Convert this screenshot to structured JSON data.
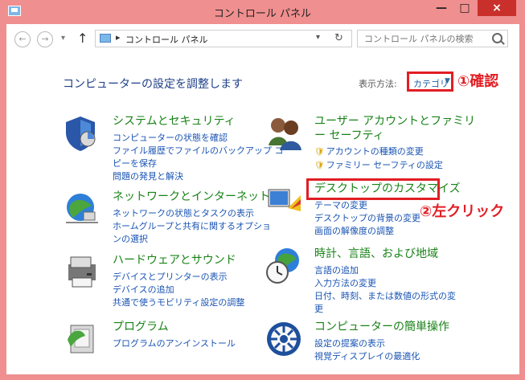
{
  "titlebar": {
    "title": "コントロール パネル",
    "minimize_icon": "minimize-icon",
    "maximize_icon": "maximize-icon",
    "close_icon": "close-icon"
  },
  "navigation": {
    "back_icon": "arrow-left-icon",
    "forward_icon": "arrow-right-icon",
    "up_icon": "arrow-up-icon",
    "breadcrumb": "コントロール パネル",
    "search_placeholder": "コントロール パネルの検索",
    "refresh_icon": "refresh-icon"
  },
  "header": {
    "title": "コンピューターの設定を調整します",
    "view_by_label": "表示方法:",
    "view_by_value": "カテゴリ",
    "annotation_1": "①確認",
    "annotation_2": "②左クリック",
    "annotation_color": "#e11e24"
  },
  "categories": [
    {
      "title": "システムとセキュリティ",
      "icon": "shield-chart-icon",
      "links": [
        "コンピューターの状態を確認",
        "ファイル履歴でファイルのバックアップ コ",
        "ピーを保存",
        "問題の発見と解決"
      ]
    },
    {
      "title": "ユーザー アカウントとファミリ",
      "title_line_2": "ー セーフティ",
      "icon": "users-icon",
      "links": [
        "アカウントの種類の変更",
        "ファミリー セーフティの設定"
      ]
    },
    {
      "title": "ネットワークとインターネット",
      "icon": "network-globe-icon",
      "links": [
        "ネットワークの状態とタスクの表示",
        "ホームグループと共有に関するオプショ",
        "ンの選択"
      ]
    },
    {
      "title": "デスクトップのカスタマイズ",
      "icon": "desktop-palette-icon",
      "links": [
        "テーマの変更",
        "デスクトップの背景の変更",
        "画面の解像度の調整"
      ]
    },
    {
      "title": "ハードウェアとサウンド",
      "icon": "printer-icon",
      "links": [
        "デバイスとプリンターの表示",
        "デバイスの追加",
        "共通で使うモビリティ設定の調整"
      ]
    },
    {
      "title": "時計、言語、および地域",
      "icon": "clock-globe-icon",
      "links": [
        "言語の追加",
        "入力方法の変更",
        "日付、時刻、または数値の形式の変",
        "更"
      ]
    },
    {
      "title": "プログラム",
      "icon": "programs-icon",
      "links": [
        "プログラムのアンインストール"
      ]
    },
    {
      "title": "コンピューターの簡単操作",
      "icon": "accessibility-icon",
      "links": [
        "設定の提案の表示",
        "視覚ディスプレイの最適化"
      ]
    }
  ]
}
